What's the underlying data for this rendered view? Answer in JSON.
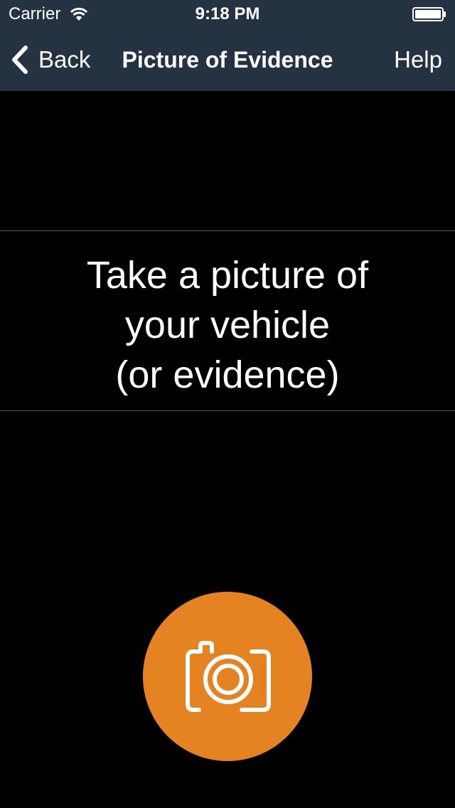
{
  "status_bar": {
    "carrier": "Carrier",
    "time": "9:18 PM",
    "wifi_icon": "wifi-icon",
    "battery_icon": "battery-full-icon"
  },
  "nav_bar": {
    "back_label": "Back",
    "title": "Picture of Evidence",
    "help_label": "Help"
  },
  "instruction": {
    "lines": [
      "Take a picture of",
      "your vehicle",
      "(or evidence)"
    ]
  },
  "camera_button": {
    "icon": "camera-icon"
  },
  "colors": {
    "nav_background": "#253242",
    "screen_background": "#000000",
    "camera_button": "#e58323",
    "text": "#ffffff"
  }
}
